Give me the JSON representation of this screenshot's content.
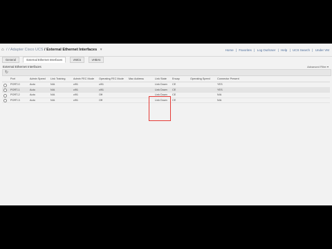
{
  "breadcrumb": {
    "home_icon": "home-icon",
    "items": [
      "/",
      "/",
      "Adapter Cisco UCS",
      "/ External Ethernet Interfaces"
    ],
    "caret": "▾"
  },
  "top_links": [
    "Home",
    "|",
    "Favorites",
    "|",
    "Log Out/User",
    "|",
    "Help",
    "|",
    "UCS Search",
    "|",
    "Under VM"
  ],
  "tabs": [
    "General",
    "External Ethernet Interfaces",
    "vNICs",
    "vHBAs"
  ],
  "active_tab_index": 1,
  "section": {
    "title": "External Ethernet Interfaces",
    "right_label": "Advanced Filter ▾"
  },
  "toolbar": {
    "refresh_icon": "refresh-icon"
  },
  "table": {
    "columns": [
      "Port",
      "Admin Speed",
      "Link Training",
      "Admin FEC Mode",
      "Operating FEC Mode",
      "Mac Address",
      "Link State",
      "Encap",
      "Operating Speed",
      "Connector Present"
    ],
    "rows": [
      [
        "PORT-0",
        "Auto",
        "N/A",
        "cl91",
        "cl91",
        "",
        "Link Down",
        "CE",
        "",
        "YES"
      ],
      [
        "PORT-1",
        "Auto",
        "N/A",
        "cl91",
        "cl91",
        "",
        "Link Down",
        "CE",
        "",
        "YES"
      ],
      [
        "PORT-2",
        "Auto",
        "N/A",
        "cl91",
        "Off",
        "",
        "Link Down",
        "CE",
        "",
        "N/A"
      ],
      [
        "PORT-3",
        "Auto",
        "N/A",
        "cl91",
        "Off",
        "",
        "Link Down",
        "CE",
        "",
        "N/A"
      ]
    ],
    "selected_row_index": 1
  },
  "colors": {
    "highlight": "#e53935",
    "link": "#4a6b9a",
    "background": "#f2f2f2"
  }
}
